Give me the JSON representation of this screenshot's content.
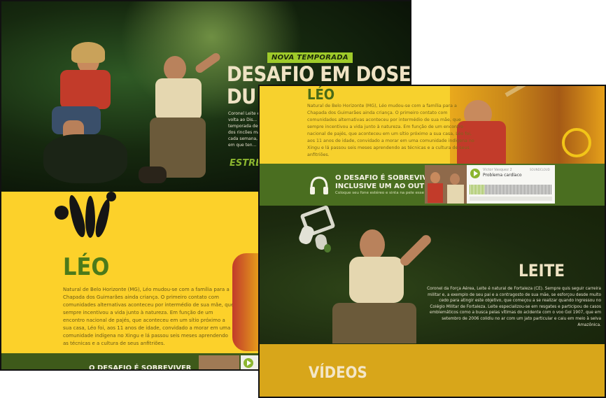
{
  "back_page": {
    "hero": {
      "tag": "NOVA TEMPORADA",
      "headline": "DESAFIO EM DOSE DU",
      "text": "Coronel Leite e ... volta ao Dis... temporada des... dos rincões mais... cada semana, ele... em que ten...",
      "green_text": "ESTRÉ"
    },
    "leo": {
      "title": "LÉO",
      "body": "Natural de Belo Horizonte (MG), Léo mudou-se com a família para a Chapada dos Guimarães ainda criança. O primeiro contato com comunidades alternativas aconteceu por intermédio de sua mãe, que sempre incentivou a vida junto à natureza. Em função de um encontro nacional de pajés, que aconteceu em um sítio próximo a sua casa, Léo foi, aos 11 anos de idade, convidado a morar em uma comunidade indígena no Xingu e lá passou seis meses aprendendo as técnicas e a cultura de seus anfitriões."
    },
    "footer_text": "O DESAFIO É SOBREVIVER"
  },
  "front_page": {
    "leo": {
      "title": "LÉO",
      "body": "Natural de Belo Horizonte (MG), Léo mudou-se com a família para a Chapada dos Guimarães ainda criança. O primeiro contato com comunidades alternativas aconteceu por intermédio de sua mãe, que sempre incentivou a vida junto à natureza. Em função de um encontro nacional de pajés, que aconteceu em um sítio próximo a sua casa, Léo foi, aos 11 anos de idade, convidado a morar em uma comunidade indígena no Xingu e lá passou seis meses aprendendo as técnicas e a cultura de seus anfitriões."
    },
    "audio": {
      "title_line1": "O DESAFIO É SOBREVIVER.",
      "title_line2": "INCLUSIVE UM AO OUTRO.",
      "subtitle": "Coloque seu fone estéreo e sinta na pele esse desafio.",
      "player": {
        "user": "Victor Vasquez 2",
        "track": "Problema cardíaco",
        "brand": "SOUNDCLOUD",
        "progress": 0.19
      }
    },
    "leite": {
      "title": "LEITE",
      "body": "Coronel da Força Aérea, Leite é natural de Fortaleza (CE). Sempre quis seguir carreira militar e, a exemplo de seu pai e a contragosto de sua mãe, se esforçou desde muito cedo para atingir este objetivo, que começou a se realizar quando ingressou no Colégio Militar de Fortaleza. Leite especializou-se em resgates e participou de casos emblemáticos como a busca pelas vítimas do acidente com o voo Gol 1907, que em setembro de 2006 colidiu no ar com um jato particular e caiu em meio à selva Amazônica."
    },
    "videos": {
      "title": "VÍDEOS"
    }
  },
  "colors": {
    "yellow": "#fcd12a",
    "dark_green": "#1c2a0f",
    "olive": "#4a6e20",
    "accent_green": "#8bb52f",
    "mustard": "#d8a61a"
  }
}
